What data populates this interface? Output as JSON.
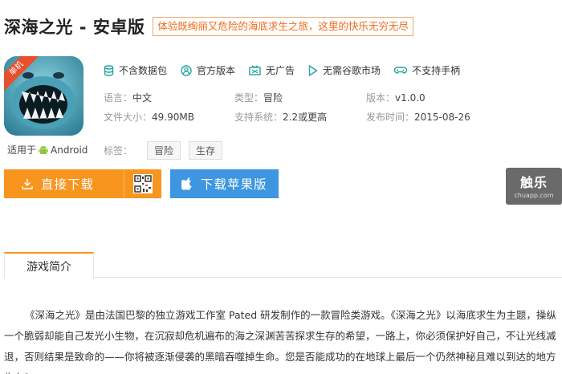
{
  "app": {
    "title": "深海之光 - 安卓版",
    "slogan": "体验既绚丽又危险的海底求生之旅，这里的快乐无穷无尽",
    "icon_badge": "单机",
    "fits_label": "适用于",
    "fits_platform": "Android"
  },
  "features": [
    {
      "icon": "database-icon",
      "label": "不含数据包"
    },
    {
      "icon": "official-user-icon",
      "label": "官方版本"
    },
    {
      "icon": "no-ads-icon",
      "label": "无广告"
    },
    {
      "icon": "play-store-icon",
      "label": "无需谷歌市场"
    },
    {
      "icon": "gamepad-icon",
      "label": "不支持手柄"
    }
  ],
  "info": {
    "language_label": "语言：",
    "language": "中文",
    "type_label": "类型：",
    "type": "冒险",
    "version_label": "版本：",
    "version": "v1.0.0",
    "size_label": "文件大小：",
    "size": "49.90MB",
    "system_label": "支持系统：",
    "system": "2.2或更高",
    "date_label": "发布时间：",
    "date": "2015-08-26"
  },
  "tags": {
    "label": "标签：",
    "items": [
      "冒险",
      "生存"
    ]
  },
  "buttons": {
    "download": "直接下载",
    "apple": "下载苹果版"
  },
  "watermark": {
    "main": "触乐",
    "sub": "chuapp.com"
  },
  "tabs": {
    "active": "游戏简介"
  },
  "description": "《深海之光》是由法国巴黎的独立游戏工作室 Pated 研发制作的一款冒险类游戏。《深海之光》以海底求生为主题，操纵一个脆弱却能自己发光小生物，在沉寂却危机遍布的海之深渊苦苦探求生存的希望，一路上，你必须保护好自己，不让光线减退，否则结果是致命的——你将被逐渐侵袭的黑暗吞噬掉生命。您是否能成功的在地球上最后一个仍然神秘且难以到达的地方生存？",
  "colors": {
    "orange": "#f7951e",
    "blue": "#3d96df",
    "teal_icon": "#22a5a0"
  }
}
